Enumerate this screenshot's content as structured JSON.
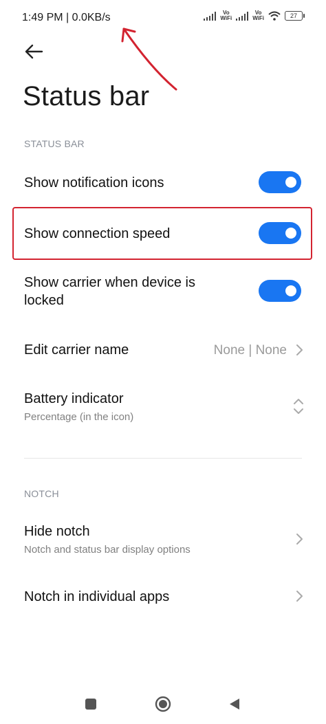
{
  "status_bar": {
    "time_speed": "1:49 PM | 0.0KB/s",
    "vo_wifi_label": "Vo\nWiFi",
    "battery": "27"
  },
  "header": {
    "back": "back-arrow-icon",
    "title": "Status bar"
  },
  "sections": [
    {
      "header": "STATUS BAR",
      "items": [
        {
          "label": "Show notification icons",
          "toggle": true
        },
        {
          "label": "Show connection speed",
          "toggle": true,
          "highlighted": true
        },
        {
          "label": "Show carrier when device is locked",
          "label_line1": "Show carrier when device is",
          "label_line2": "locked",
          "toggle": true
        },
        {
          "label": "Edit carrier name",
          "value": "None | None"
        },
        {
          "label": "Battery indicator",
          "subtitle": "Percentage (in the icon)"
        }
      ]
    },
    {
      "header": "NOTCH",
      "items": [
        {
          "label": "Hide notch",
          "subtitle": "Notch and status bar display options"
        },
        {
          "label": "Notch in individual apps"
        }
      ]
    }
  ],
  "colors": {
    "accent": "#1976f2",
    "annotation": "#d32330"
  },
  "nav_bar": [
    "recents-square-icon",
    "home-circle-icon",
    "back-triangle-icon"
  ]
}
